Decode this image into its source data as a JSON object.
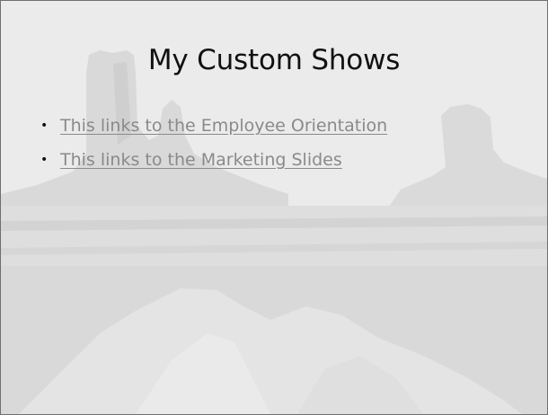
{
  "slide": {
    "title": "My Custom Shows",
    "bullets": [
      {
        "bullet": "•",
        "label": "This links to the Employee Orientation"
      },
      {
        "bullet": "•",
        "label": "This links to the Marketing Slides"
      }
    ]
  },
  "colors": {
    "title_text": "#111111",
    "link_text": "#8a8a8a",
    "background": "#e6e6e6",
    "border": "#6f6f6f"
  },
  "background_image": "monument-valley-washed-out"
}
